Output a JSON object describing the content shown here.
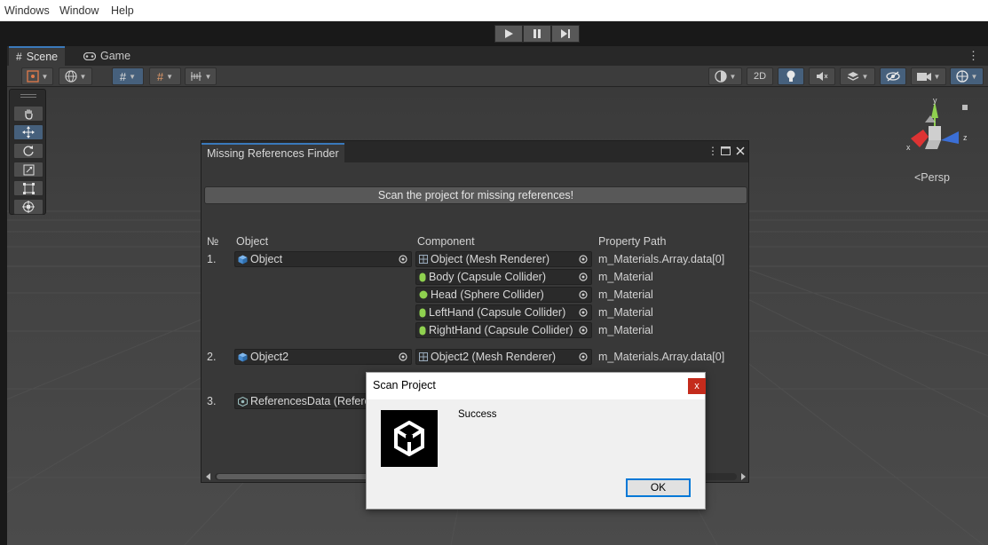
{
  "menubar": {
    "items": [
      "Windows",
      "Window",
      "Help"
    ]
  },
  "playbar": {
    "buttons": [
      "play-icon",
      "pause-icon",
      "step-icon"
    ]
  },
  "tabs": [
    {
      "label": "Scene",
      "icon": "hash-icon"
    },
    {
      "label": "Game",
      "icon": "gamepad-icon"
    }
  ],
  "scene_toolbar": {
    "mode_2d_label": "2D"
  },
  "viewport": {
    "projection_label": "<Persp",
    "gizmo_axes": [
      "y",
      "x",
      "z"
    ]
  },
  "finder": {
    "title": "Missing References Finder",
    "scan_button": "Scan the project for missing references!",
    "columns": {
      "number": "№",
      "object": "Object",
      "component": "Component",
      "property": "Property Path"
    },
    "rows": [
      {
        "number": "1.",
        "object": "Object",
        "components": [
          {
            "name": "Object (Mesh Renderer)",
            "icon": "mesh-renderer-icon",
            "property": "m_Materials.Array.data[0]"
          },
          {
            "name": "Body (Capsule Collider)",
            "icon": "capsule-collider-icon",
            "property": "m_Material"
          },
          {
            "name": "Head (Sphere Collider)",
            "icon": "sphere-collider-icon",
            "property": "m_Material"
          },
          {
            "name": "LeftHand (Capsule Collider)",
            "icon": "capsule-collider-icon",
            "property": "m_Material"
          },
          {
            "name": "RightHand (Capsule Collider)",
            "icon": "capsule-collider-icon",
            "property": "m_Material"
          }
        ]
      },
      {
        "number": "2.",
        "object": "Object2",
        "components": [
          {
            "name": "Object2 (Mesh Renderer)",
            "icon": "mesh-renderer-icon",
            "property": "m_Materials.Array.data[0]"
          }
        ]
      },
      {
        "number": "3.",
        "object": "ReferencesData (References",
        "components": []
      }
    ]
  },
  "dialog": {
    "title": "Scan Project",
    "message": "Success",
    "ok_label": "OK",
    "close_label": "x"
  },
  "colors": {
    "accent": "#3a79bb",
    "toggle_on": "#46607c",
    "close_red": "#c42b1c",
    "ok_border": "#0078d7",
    "collider_green": "#8fd14f"
  }
}
